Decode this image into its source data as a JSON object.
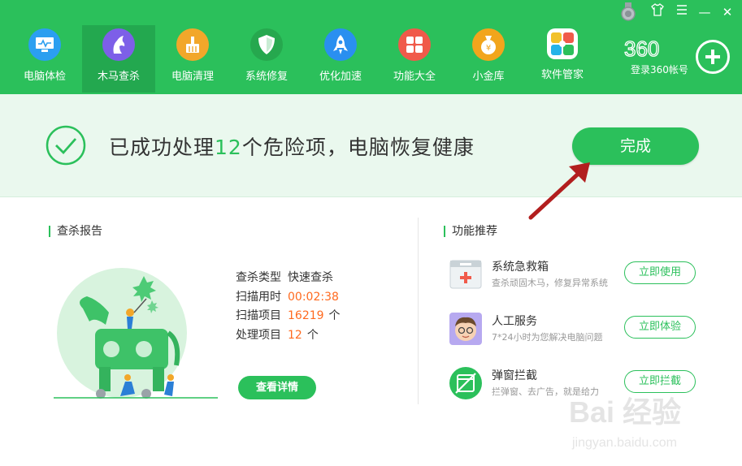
{
  "window_controls": {
    "medal_icon": "medal-icon",
    "skin_icon": "shirt-icon",
    "menu_icon": "menu-icon",
    "minimize_label": "—",
    "close_label": "✕"
  },
  "nav": {
    "items": [
      {
        "label": "电脑体检",
        "icon": "monitor-icon",
        "color": "#2b9ff0"
      },
      {
        "label": "木马查杀",
        "icon": "horse-icon",
        "color": "#7d5fe8"
      },
      {
        "label": "电脑清理",
        "icon": "broom-icon",
        "color": "#f2a72a"
      },
      {
        "label": "系统修复",
        "icon": "shield-icon",
        "color": "#26a84e"
      },
      {
        "label": "优化加速",
        "icon": "rocket-icon",
        "color": "#2a8ff0"
      },
      {
        "label": "功能大全",
        "icon": "grid-icon",
        "color": "#f05a4a"
      },
      {
        "label": "小金库",
        "icon": "money-bag-icon",
        "color": "#f2a51c"
      },
      {
        "label": "软件管家",
        "icon": "flower-icon",
        "color": "#ffffff"
      }
    ],
    "active_index": 1
  },
  "brand": {
    "logo_text": "360",
    "login_text": "登录360帐号"
  },
  "banner": {
    "prefix": "已成功处理",
    "count": "12",
    "suffix": "个危险项，电脑恢复健康",
    "done_label": "完成"
  },
  "report": {
    "title": "查杀报告",
    "rows": [
      {
        "label": "查杀类型",
        "value": "快速查杀",
        "unit": ""
      },
      {
        "label": "扫描用时",
        "value": "00:02:38",
        "unit": ""
      },
      {
        "label": "扫描项目",
        "value": "16219",
        "unit": "个"
      },
      {
        "label": "处理项目",
        "value": "12",
        "unit": "个"
      }
    ],
    "details_label": "查看详情"
  },
  "recommend": {
    "title": "功能推荐",
    "items": [
      {
        "name": "系统急救箱",
        "desc": "查杀顽固木马，修复异常系统",
        "button": "立即使用",
        "icon": "first-aid-kit-icon"
      },
      {
        "name": "人工服务",
        "desc": "7*24小时为您解决电脑问题",
        "button": "立即体验",
        "icon": "support-agent-icon"
      },
      {
        "name": "弹窗拦截",
        "desc": "拦弹窗、去广告，就是给力",
        "button": "立即拦截",
        "icon": "popup-block-icon"
      }
    ]
  },
  "watermark": {
    "text": "Bai 经验",
    "sub": "jingyan.baidu.com"
  },
  "colors": {
    "primary": "#2bc05b",
    "active_nav": "#23a84f",
    "highlight": "#ff6a1f",
    "arrow": "#b21e1e"
  }
}
